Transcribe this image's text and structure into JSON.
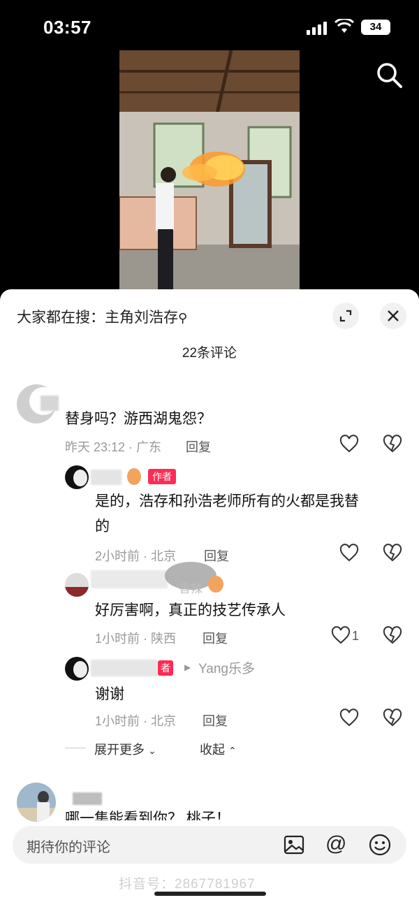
{
  "status": {
    "time": "03:57",
    "battery": "34"
  },
  "sheet": {
    "search_hint": "大家都在搜：主角刘浩存",
    "comment_count": "22条评论"
  },
  "comments": {
    "c1": {
      "text": "替身吗？游西湖鬼怨？",
      "meta": "昨天 23:12 · 广东",
      "reply": "回复"
    },
    "r1": {
      "tag": "作者",
      "text1": "是的，浩存和孙浩老师所有的火都是我替",
      "text2": "的",
      "meta": "2小时前 · 北京",
      "reply": "回复"
    },
    "r2": {
      "name_tail": "香辣",
      "text": "好厉害啊，真正的技艺传承人",
      "meta": "1小时前 · 陕西",
      "reply": "回复",
      "likes": "1"
    },
    "r3": {
      "tag": "者",
      "reply_to": "Yang乐多",
      "text": "谢谢",
      "meta": "1小时前 · 北京",
      "reply": "回复"
    },
    "expand": "展开更多",
    "collapse": "收起",
    "c2": {
      "text": "哪一集能看到你？ 桃子！"
    }
  },
  "input": {
    "placeholder": "期待你的评论"
  },
  "watermark": "抖音号：2867781967"
}
